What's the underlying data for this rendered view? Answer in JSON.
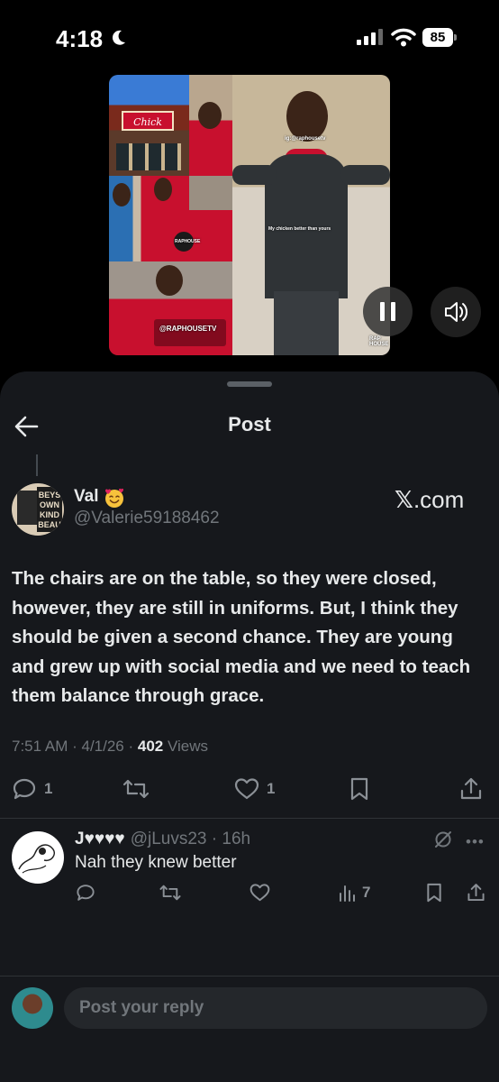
{
  "status_bar": {
    "time": "4:18",
    "battery": "85"
  },
  "video": {
    "watermark_top": "ig:@raphousetv",
    "caption_small": "My chicken better than yours",
    "watermark_bottom": "@RAPHOUSETV",
    "watermark_corner": "RAP HOUSE",
    "overlay_logo": "RAPHOUSE"
  },
  "sheet": {
    "title": "Post"
  },
  "post": {
    "author_name": "Val",
    "author_handle": "@Valerie59188462",
    "watermark": ".com",
    "text": "The chairs are on the table, so they were closed, however, they are still in uniforms.  But, I think they should be given a second chance. They are young and grew up with social media and we need to teach them balance through grace.",
    "time": "7:51 AM",
    "date": "4/1/26",
    "views_count": "402",
    "views_label": "Views",
    "replies": "1",
    "likes": "1"
  },
  "reply": {
    "name": "J♥♥♥♥",
    "handle": "@jLuvs23",
    "age": "16h",
    "text": "Nah they knew better",
    "views": "7"
  },
  "composer": {
    "placeholder": "Post your reply"
  },
  "colors": {
    "background": "#000000",
    "sheet": "#16181c",
    "text_primary": "#e7e9ea",
    "text_secondary": "#71767b",
    "divider": "#2f3336"
  }
}
